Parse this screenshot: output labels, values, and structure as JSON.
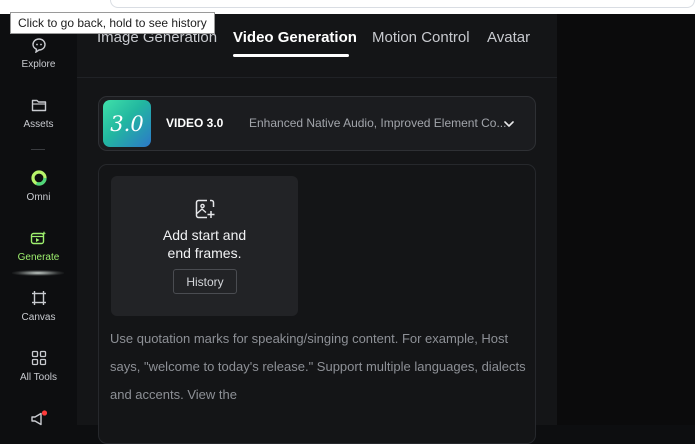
{
  "tooltip": "Click to go back, hold to see history",
  "sidebar": {
    "items": [
      {
        "label": "Explore",
        "icon": "explore-icon"
      },
      {
        "label": "Assets",
        "icon": "folder-icon"
      },
      {
        "label": "Omni",
        "icon": "omni-ring-icon"
      },
      {
        "label": "Generate",
        "icon": "generate-icon",
        "active": true
      },
      {
        "label": "Canvas",
        "icon": "canvas-icon"
      },
      {
        "label": "All Tools",
        "icon": "grid-icon"
      },
      {
        "label": "",
        "icon": "megaphone-icon",
        "badge": true
      }
    ]
  },
  "tabs": [
    {
      "label": "Image Generation"
    },
    {
      "label": "Video Generation",
      "active": true
    },
    {
      "label": "Motion Control"
    },
    {
      "label": "Avatar"
    }
  ],
  "model": {
    "logo_text": "3.0",
    "name": "VIDEO 3.0",
    "description": "Enhanced Native Audio, Improved Element Co..."
  },
  "frames": {
    "text": "Add start and end frames.",
    "history_label": "History"
  },
  "prompt_placeholder": "Use quotation marks for speaking/singing content. For example, Host says, \"welcome to today's release.\" Support multiple languages, dialects and accents. View the",
  "colors": {
    "accent": "#9ef06e",
    "background": "#141517",
    "sidebar": "#0d0e10"
  }
}
